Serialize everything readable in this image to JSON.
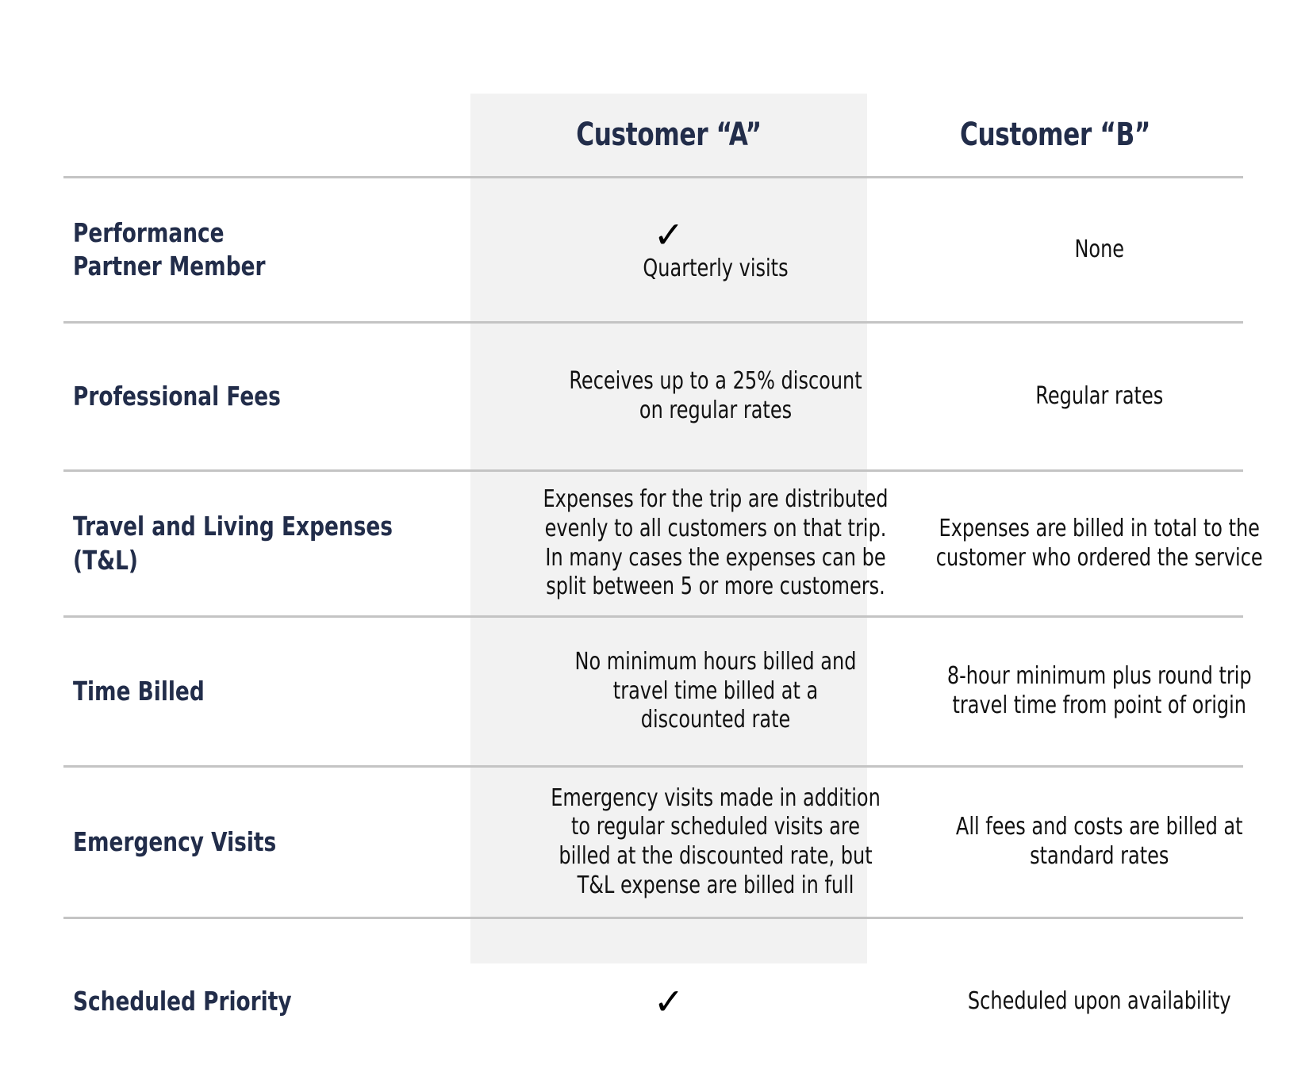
{
  "table": {
    "columns": [
      {
        "key": "label",
        "header": ""
      },
      {
        "key": "a",
        "header": "Customer “A”",
        "highlighted": true
      },
      {
        "key": "b",
        "header": "Customer “B”",
        "highlighted": false
      }
    ],
    "check_glyph": "✓",
    "rows": [
      {
        "label": "Performance\nPartner Member",
        "a_check": true,
        "a": "Quarterly visits",
        "b_check": false,
        "b": "None"
      },
      {
        "label": "Professional Fees",
        "a_check": false,
        "a": "Receives up to a 25% discount\non regular rates",
        "b_check": false,
        "b": "Regular rates"
      },
      {
        "label": "Travel and Living Expenses\n(T&L)",
        "a_check": false,
        "a": "Expenses for the trip are distributed\nevenly to all customers on that trip.\nIn many cases the expenses can be\nsplit between 5 or more customers.",
        "b_check": false,
        "b": "Expenses are billed in total to the\ncustomer who ordered the service"
      },
      {
        "label": "Time Billed",
        "a_check": false,
        "a": "No minimum hours billed and\ntravel time billed at a\ndiscounted rate",
        "b_check": false,
        "b": "8-hour minimum plus round trip\ntravel time from point of origin"
      },
      {
        "label": "Emergency Visits",
        "a_check": false,
        "a": "Emergency visits made in addition\nto regular scheduled visits are\nbilled at the discounted rate, but\nT&L expense are billed in full",
        "b_check": false,
        "b": "All fees and costs are billed at\nstandard rates"
      },
      {
        "label": "Scheduled Priority",
        "a_check": true,
        "a": "",
        "b_check": false,
        "b": "Scheduled upon availability"
      }
    ]
  },
  "colors": {
    "label_navy": "#222d4a",
    "body_text": "#111111",
    "highlight_band": "#f2f2f2",
    "rule": "#c4c4c4",
    "page_background": "#ffffff"
  }
}
